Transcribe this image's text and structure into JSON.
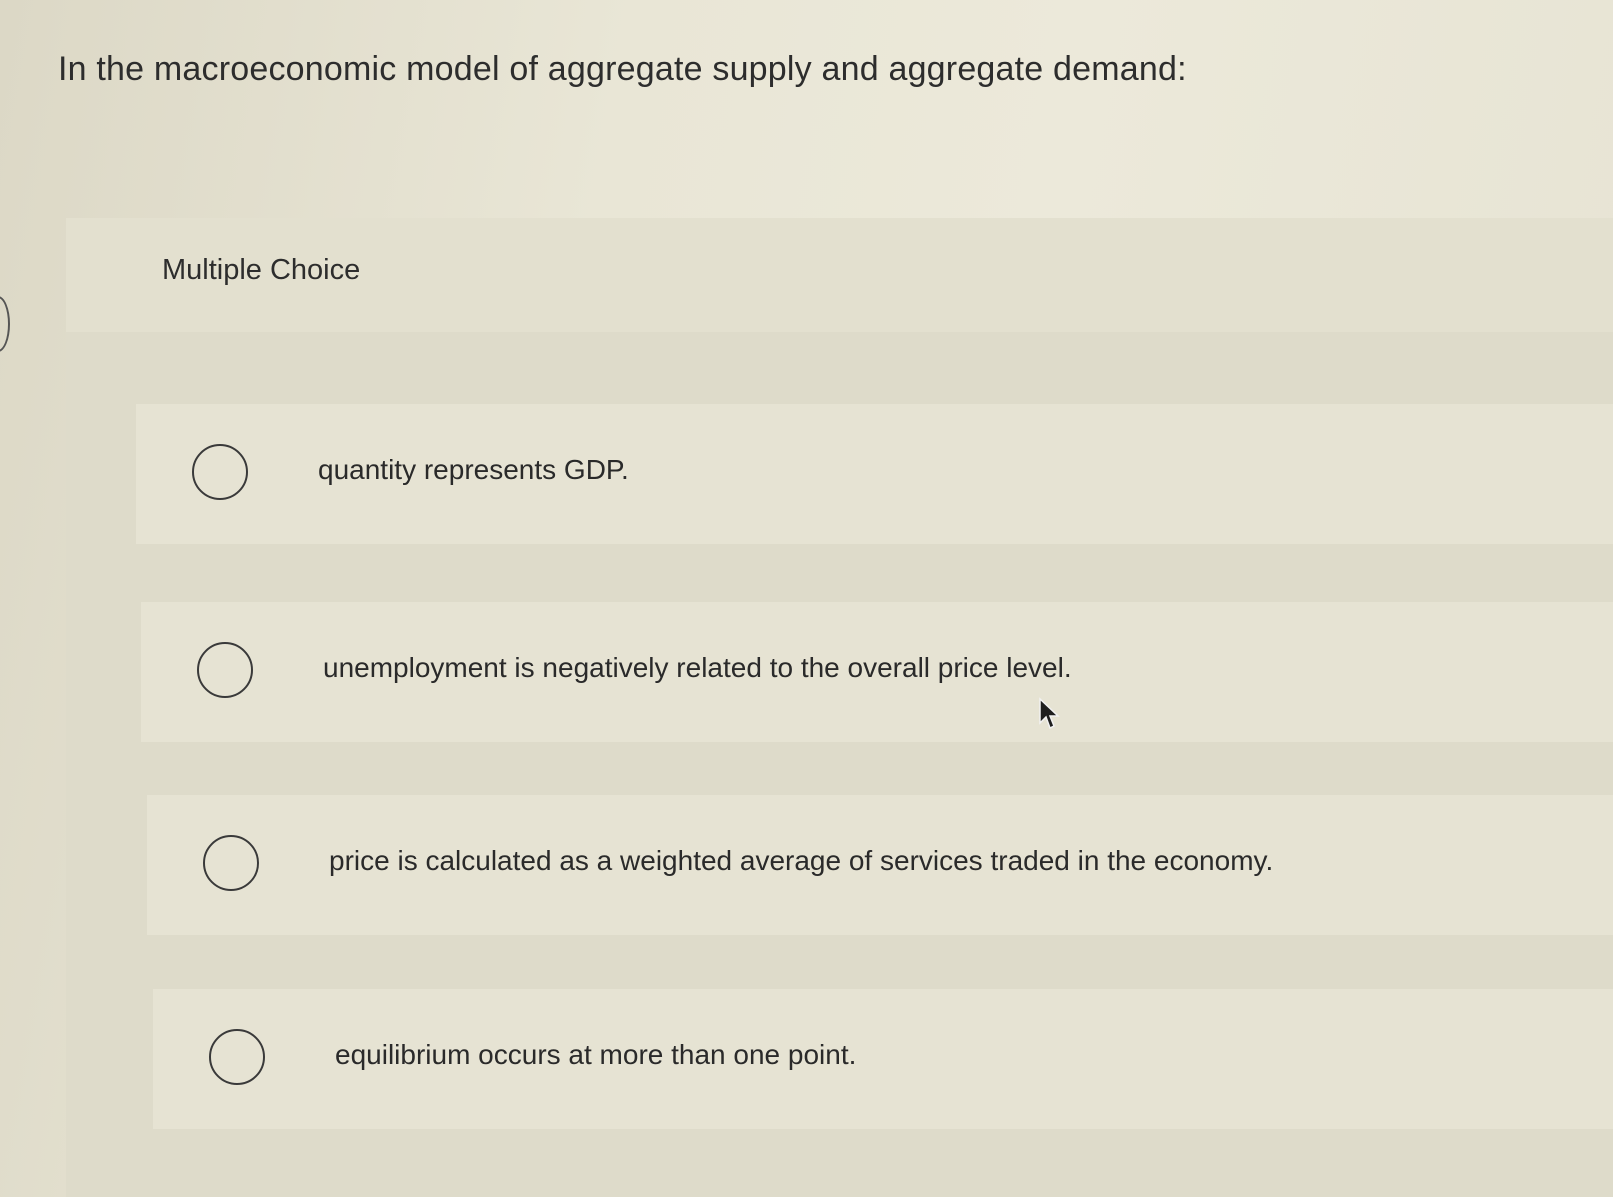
{
  "question": {
    "text": "In the macroeconomic model of aggregate supply and aggregate demand:"
  },
  "panel": {
    "type_label": "Multiple Choice"
  },
  "options": [
    {
      "label": "quantity represents GDP."
    },
    {
      "label": "unemployment is negatively related to the overall price level."
    },
    {
      "label": "price is calculated as a weighted average of services traded in the economy."
    },
    {
      "label": "equilibrium occurs at more than one point."
    }
  ]
}
